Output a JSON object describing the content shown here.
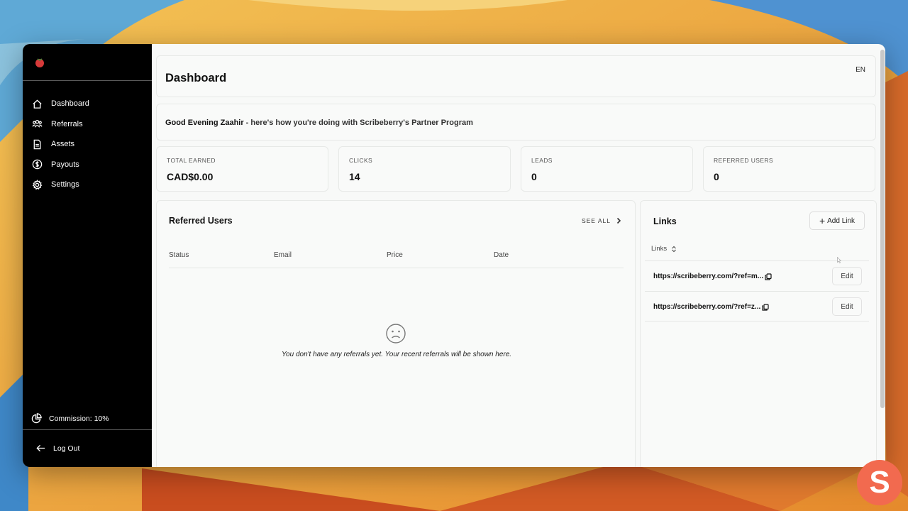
{
  "sidebar": {
    "items": [
      {
        "label": "Dashboard",
        "icon": "home-icon"
      },
      {
        "label": "Referrals",
        "icon": "users-icon"
      },
      {
        "label": "Assets",
        "icon": "document-icon"
      },
      {
        "label": "Payouts",
        "icon": "dollar-icon"
      },
      {
        "label": "Settings",
        "icon": "gear-icon"
      }
    ],
    "commission": "Commission: 10%",
    "logout": "Log Out"
  },
  "header": {
    "title": "Dashboard",
    "language": "EN"
  },
  "greeting": {
    "name_part": "Good Evening Zaahir",
    "rest": " - here's how you're doing with Scribeberry's Partner Program"
  },
  "stats": [
    {
      "label": "TOTAL EARNED",
      "value": "CAD$0.00"
    },
    {
      "label": "CLICKS",
      "value": "14"
    },
    {
      "label": "LEADS",
      "value": "0"
    },
    {
      "label": "REFERRED USERS",
      "value": "0"
    }
  ],
  "referred_users": {
    "title": "Referred Users",
    "see_all": "SEE ALL",
    "columns": [
      "Status",
      "Email",
      "Price",
      "Date"
    ],
    "empty_message": "You don't have any referrals yet. Your recent referrals will be shown here."
  },
  "links": {
    "title": "Links",
    "add_label": "Add Link",
    "column": "Links",
    "rows": [
      {
        "url": "https://scribeberry.com/?ref=m...",
        "edit": "Edit"
      },
      {
        "url": "https://scribeberry.com/?ref=z...",
        "edit": "Edit"
      }
    ]
  },
  "colors": {
    "sidebar_bg": "#000000",
    "content_bg": "#f8f9f8",
    "badge": "#f26a4f"
  },
  "badge_letter": "S"
}
